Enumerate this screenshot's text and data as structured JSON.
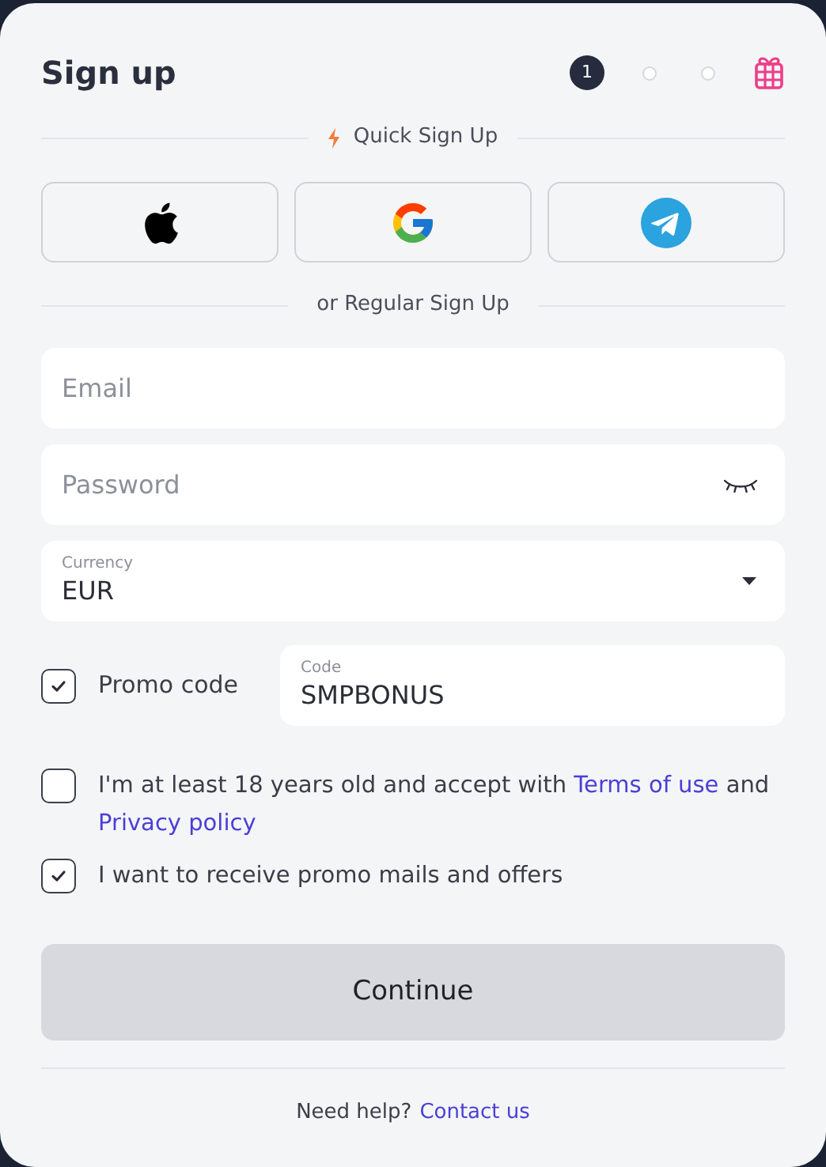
{
  "title": "Sign up",
  "steps": [
    {
      "label": "1",
      "selected": true
    },
    {
      "selected": false
    },
    {
      "selected": false
    }
  ],
  "quick_divider": "Quick Sign Up",
  "social_buttons": [
    {
      "kind": "apple"
    },
    {
      "kind": "google"
    },
    {
      "kind": "telegram"
    }
  ],
  "regular_divider": "or Regular Sign Up",
  "email": {
    "placeholder": "Email"
  },
  "password": {
    "placeholder": "Password"
  },
  "currency": {
    "label": "Currency",
    "value": "EUR"
  },
  "promo": {
    "label": "Promo code",
    "checked": true,
    "field_label": "Code",
    "value": "SMPBONUS"
  },
  "agreements": [
    {
      "checked": false,
      "parts": [
        {
          "text": "I'm at least 18 years old and accept with "
        },
        {
          "text": "Terms of use",
          "link": true
        },
        {
          "text": " and "
        },
        {
          "text": "Privacy policy",
          "link": true
        }
      ]
    },
    {
      "checked": true,
      "parts": [
        {
          "text": "I want to receive promo mails and offers"
        }
      ]
    }
  ],
  "continue_button": "Continue",
  "help": {
    "text": "Need help?",
    "link": "Contact us"
  }
}
